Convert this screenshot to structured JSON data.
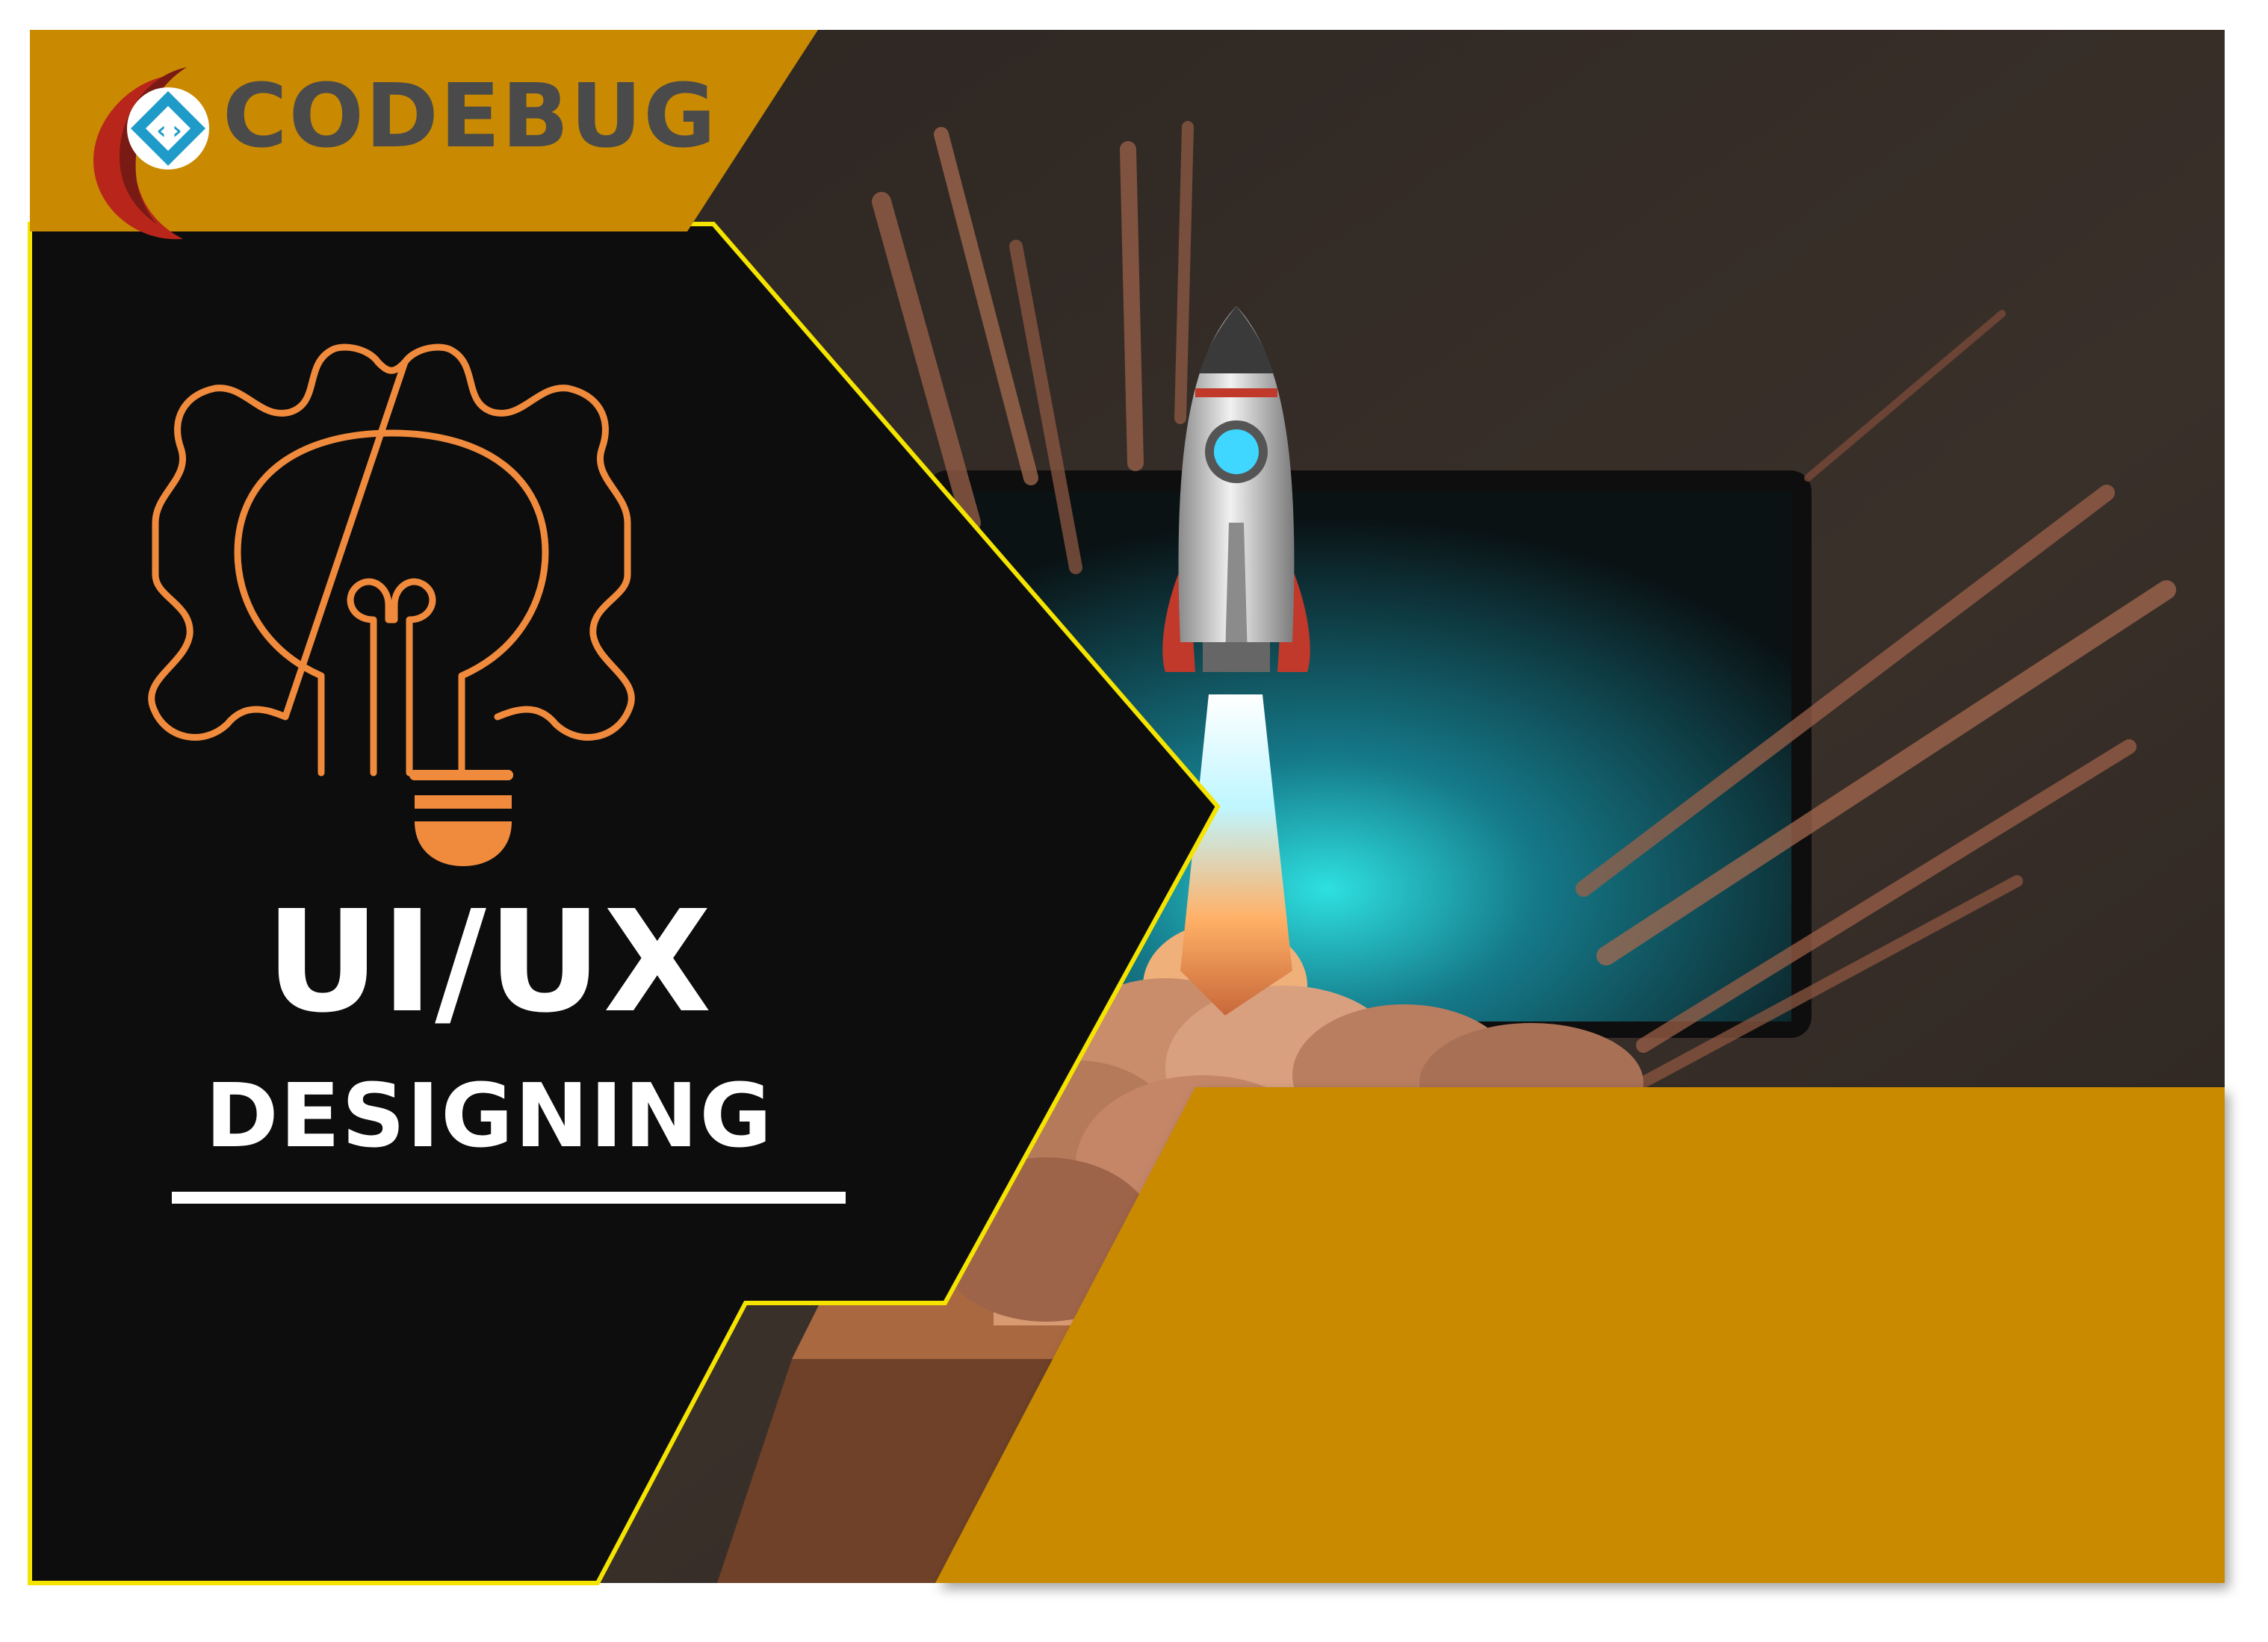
{
  "brand": {
    "name": "CODEBUG",
    "logo_icon": "code-brackets-diamond-icon"
  },
  "headline": {
    "main": "UI/UX",
    "sub": "DESIGNING"
  },
  "icons": {
    "hero": "gear-lightbulb-icon",
    "illustration": "rocket-launch-from-laptop"
  },
  "colors": {
    "gold": "#C98A02",
    "panel_black": "#0d0d0d",
    "accent_yellow": "#F5E400",
    "icon_orange": "#F08A3C",
    "logo_red": "#B8261B",
    "logo_teal": "#1E9BC9",
    "text_white": "#ffffff"
  }
}
